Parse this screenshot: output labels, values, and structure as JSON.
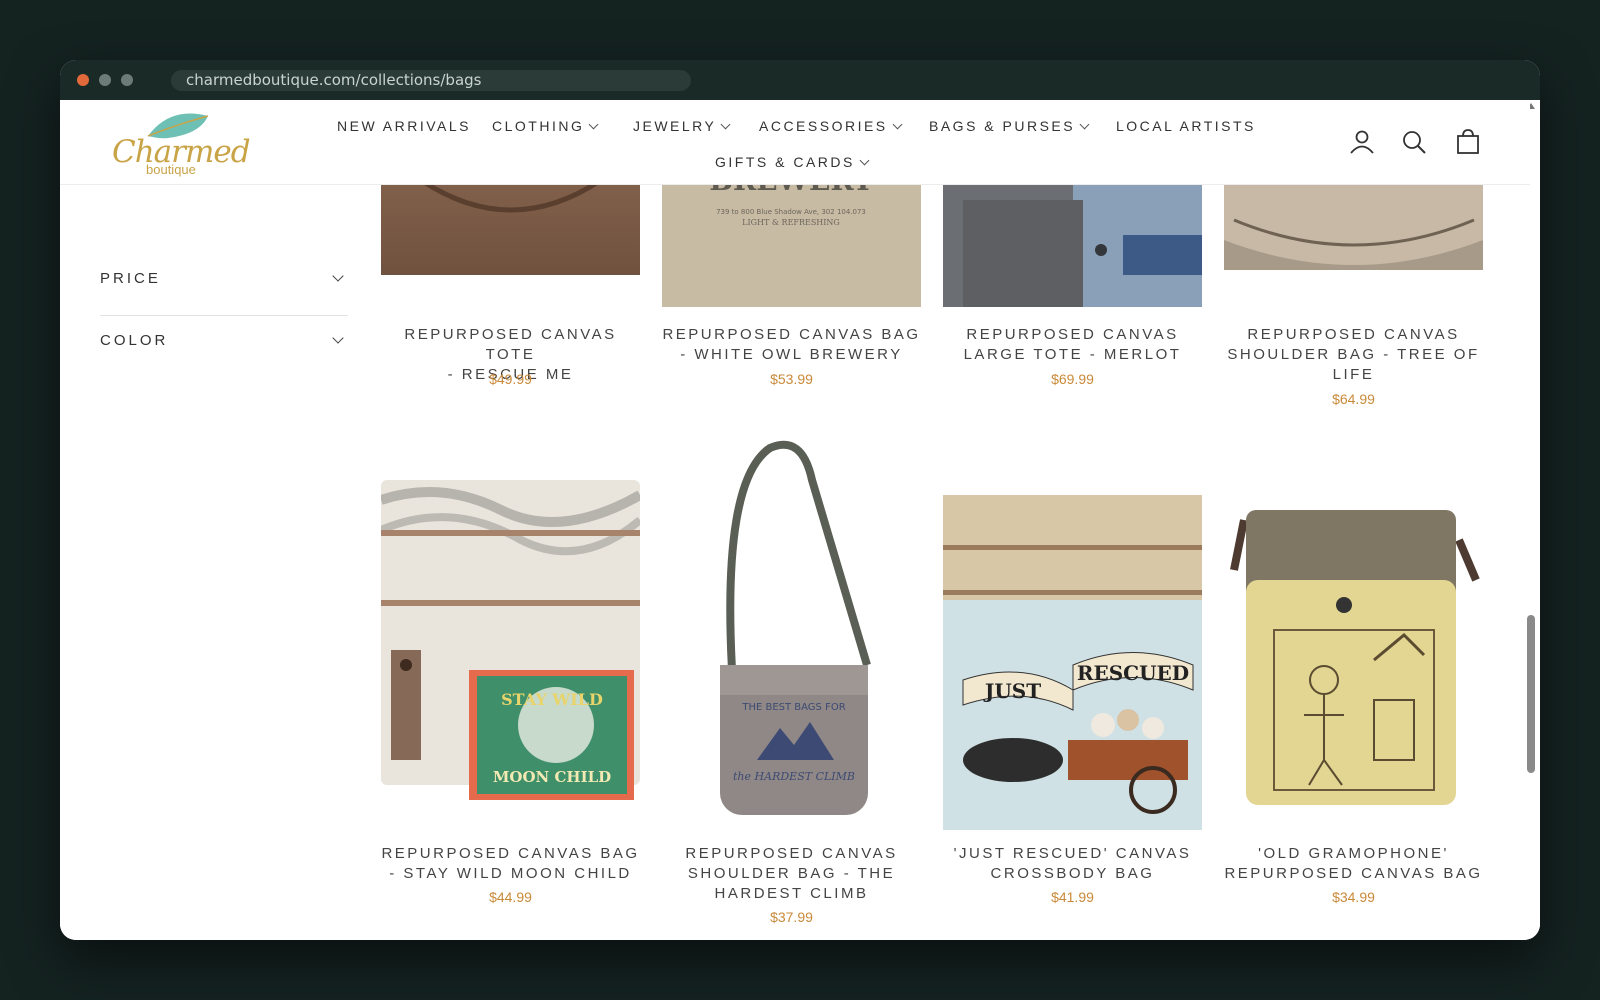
{
  "browser": {
    "url": "charmedboutique.com/collections/bags"
  },
  "header": {
    "logo_text": "Charmed",
    "logo_sub": "boutique",
    "nav": [
      {
        "label": "NEW ARRIVALS",
        "dropdown": false
      },
      {
        "label": "CLOTHING",
        "dropdown": true
      },
      {
        "label": "JEWELRY",
        "dropdown": true
      },
      {
        "label": "ACCESSORIES",
        "dropdown": true
      },
      {
        "label": "BAGS & PURSES",
        "dropdown": true
      },
      {
        "label": "LOCAL ARTISTS",
        "dropdown": false
      },
      {
        "label": "GIFTS & CARDS",
        "dropdown": true
      }
    ],
    "icons": [
      "account-icon",
      "search-icon",
      "cart-icon"
    ]
  },
  "filters": [
    {
      "label": "PRICE"
    },
    {
      "label": "COLOR"
    }
  ],
  "products_top": [
    {
      "title_line1": "REPURPOSED CANVAS TOTE",
      "title_line2": "- RESCUE ME",
      "title_line3": "",
      "price": "$49.99"
    },
    {
      "title_line1": "REPURPOSED CANVAS BAG",
      "title_line2": "- WHITE OWL BREWERY",
      "title_line3": "",
      "price": "$53.99"
    },
    {
      "title_line1": "REPURPOSED CANVAS",
      "title_line2": "LARGE TOTE - MERLOT",
      "title_line3": "",
      "price": "$69.99"
    },
    {
      "title_line1": "REPURPOSED CANVAS",
      "title_line2": "SHOULDER BAG - TREE OF",
      "title_line3": "LIFE",
      "price": "$64.99"
    }
  ],
  "products_bottom": [
    {
      "title_line1": "REPURPOSED CANVAS BAG",
      "title_line2": "- STAY WILD MOON CHILD",
      "title_line3": "",
      "price": "$44.99",
      "art_text1": "STAY WILD",
      "art_text2": "MOON CHILD"
    },
    {
      "title_line1": "REPURPOSED CANVAS",
      "title_line2": "SHOULDER BAG - THE",
      "title_line3": "HARDEST CLIMB",
      "price": "$37.99",
      "art_text1": "THE BEST BAGS FOR",
      "art_text2": "the HARDEST CLIMB"
    },
    {
      "title_line1": "'JUST RESCUED' CANVAS",
      "title_line2": "CROSSBODY BAG",
      "title_line3": "",
      "price": "$41.99",
      "art_text1": "JUST",
      "art_text2": "RESCUED"
    },
    {
      "title_line1": "'OLD GRAMOPHONE'",
      "title_line2": "REPURPOSED CANVAS BAG",
      "title_line3": "",
      "price": "$34.99",
      "art_text1": "",
      "art_text2": ""
    }
  ],
  "colors": {
    "price": "#c98a3a",
    "logo": "#c9a447",
    "window_bg": "#142220"
  }
}
